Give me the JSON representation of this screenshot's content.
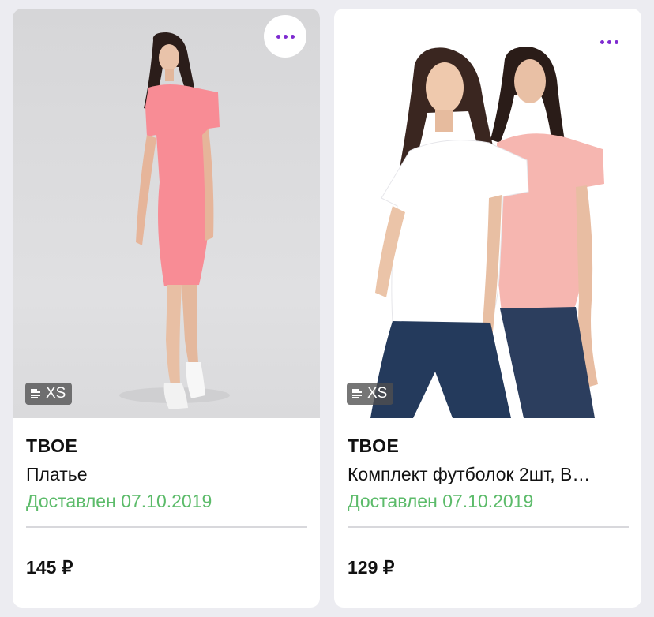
{
  "cards": [
    {
      "brand": "ТВОЕ",
      "title": "Платье",
      "status": "Доставлен 07.10.2019",
      "price": "145 ₽",
      "size": "XS",
      "image": "woman in pink fitted dress",
      "menu_icon": "more-dots-icon"
    },
    {
      "brand": "ТВОЕ",
      "title": "Комплект футболок 2шт, В…",
      "status": "Доставлен 07.10.2019",
      "price": "129 ₽",
      "size": "XS",
      "image": "two women in white and pink t-shirts",
      "menu_icon": "more-dots-icon"
    }
  ],
  "colors": {
    "accent": "#7e2bd0",
    "status_green": "#5cbb6a",
    "background": "#ececf1"
  }
}
